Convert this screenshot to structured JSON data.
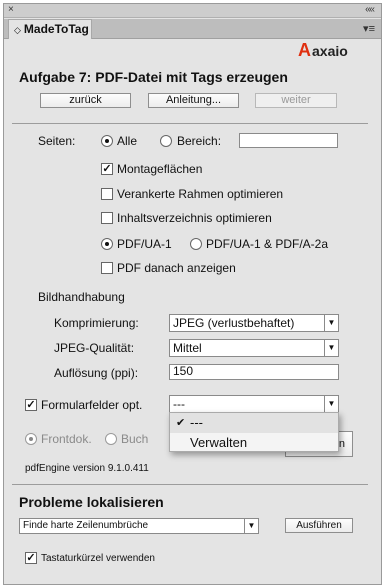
{
  "panel": {
    "tab_label": "MadeToTag",
    "tab_arrows": "◇",
    "collapse_glyph": "«",
    "close_glyph": "×",
    "menu_glyph": "≡",
    "logo_mark": "A",
    "logo_text": "axaio",
    "logo_color": "#e03010"
  },
  "task": {
    "title": "Aufgabe 7: PDF-Datei mit Tags erzeugen",
    "back_label": "zurück",
    "guide_label": "Anleitung...",
    "next_label": "weiter"
  },
  "pages": {
    "label": "Seiten:",
    "all_label": "Alle",
    "range_label": "Bereich:",
    "range_value": "",
    "selected": "all"
  },
  "options": {
    "pasteboard_label": "Montageflächen",
    "pasteboard_checked": true,
    "anchored_label": "Verankerte Rahmen optimieren",
    "anchored_checked": false,
    "toc_label": "Inhaltsverzeichnis optimieren",
    "toc_checked": false
  },
  "standard": {
    "ua1_label": "PDF/UA-1",
    "ua1_a2a_label": "PDF/UA-1 & PDF/A-2a",
    "selected": "ua1",
    "show_label": "PDF danach anzeigen",
    "show_checked": false
  },
  "images": {
    "section_label": "Bildhandhabung",
    "compression_label": "Komprimierung:",
    "compression_value": "JPEG (verlustbehaftet)",
    "quality_label": "JPEG-Qualität:",
    "quality_value": "Mittel",
    "resolution_label": "Auflösung (ppi):",
    "resolution_value": "150"
  },
  "forms": {
    "label": "Formularfelder opt.",
    "checked": true,
    "value": "---",
    "dropdown_options": [
      {
        "label": "---",
        "checked": true
      },
      {
        "label": "Verwalten",
        "checked": false
      }
    ]
  },
  "reading": {
    "frontdok_label": "Frontdok.",
    "buch_label": "Buch",
    "selected": "frontdok",
    "action_label": "Anwenden"
  },
  "engine": {
    "version": "pdfEngine version 9.1.0.411"
  },
  "problems": {
    "title": "Probleme lokalisieren",
    "select_value": "Finde harte Zeilenumbrüche",
    "run_label": "Ausführen",
    "shortcut_label": "Tastaturkürzel verwenden",
    "shortcut_checked": true
  }
}
